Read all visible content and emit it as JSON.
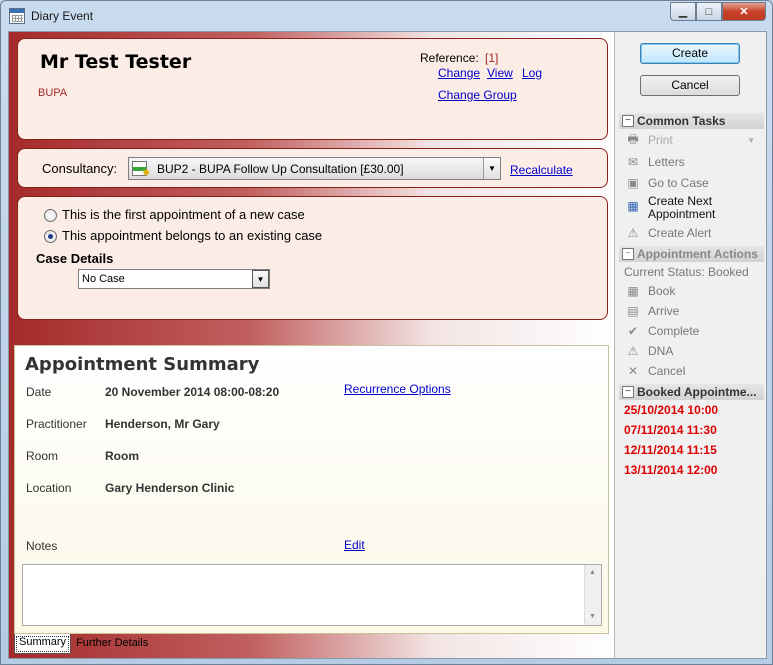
{
  "window": {
    "title": "Diary Event"
  },
  "patient": {
    "name": "Mr Test Tester",
    "payer": "BUPA",
    "reference_label": "Reference:",
    "reference_value": "[1]",
    "links": {
      "change": "Change",
      "view": "View",
      "log": "Log",
      "change_group": "Change Group"
    }
  },
  "consultancy": {
    "label": "Consultancy:",
    "value": "BUP2 - BUPA Follow Up Consultation [£30.00]",
    "recalculate": "Recalculate"
  },
  "case": {
    "option_new": "This is the first appointment of a new case",
    "option_existing": "This appointment belongs to an existing case",
    "selected": "existing",
    "details_label": "Case Details",
    "case_value": "No Case"
  },
  "summary": {
    "title": "Appointment Summary",
    "date_label": "Date",
    "date_value": "20 November 2014 08:00-08:20",
    "recurrence": "Recurrence Options",
    "practitioner_label": "Practitioner",
    "practitioner_value": "Henderson, Mr Gary",
    "room_label": "Room",
    "room_value": "Room",
    "location_label": "Location",
    "location_value": "Gary Henderson Clinic",
    "notes_label": "Notes",
    "edit": "Edit",
    "notes_value": ""
  },
  "tabs": [
    {
      "label": "Summary"
    },
    {
      "label": "Further Details"
    }
  ],
  "actions": {
    "create": "Create",
    "cancel": "Cancel"
  },
  "common_tasks": {
    "title": "Common Tasks",
    "items": [
      "Print",
      "Letters",
      "Go to Case",
      "Create Next",
      "Appointment",
      "Create Alert"
    ]
  },
  "appointment_actions": {
    "title": "Appointment Actions",
    "status": "Current Status: Booked",
    "items": [
      "Book",
      "Arrive",
      "Complete",
      "DNA",
      "Cancel"
    ]
  },
  "booked": {
    "title": "Booked Appointme...",
    "items": [
      "25/10/2014 10:00",
      "07/11/2014 11:30",
      "12/11/2014 11:15",
      "13/11/2014 12:00"
    ],
    "color": "#dd0000"
  }
}
